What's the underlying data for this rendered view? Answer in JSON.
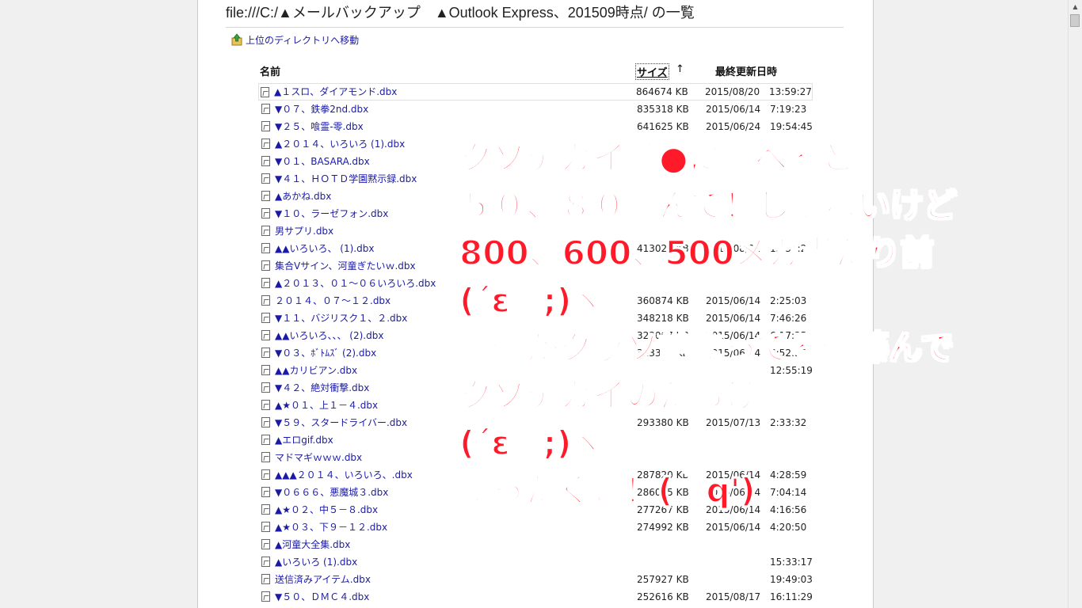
{
  "title": "file:///C:/▲メールバックアップ　▲Outlook Express、201509時点/ の一覧",
  "updir_label": "上位のディレクトリへ移動",
  "columns": {
    "name": "名前",
    "size": "サイズ",
    "sort_arrow": "↑",
    "modified": "最終更新日時"
  },
  "files": [
    {
      "name": "▲１スロ、ダイアモンド.dbx",
      "size": "864674 KB",
      "date": "2015/08/20",
      "time": "13:59:27"
    },
    {
      "name": "▼０７、鉄拳2nd.dbx",
      "size": "835318 KB",
      "date": "2015/06/14",
      "time": "7:19:23"
    },
    {
      "name": "▼２５、喰霊-零.dbx",
      "size": "641625 KB",
      "date": "2015/06/24",
      "time": "19:54:45"
    },
    {
      "name": "▲２０１４、いろいろ (1).dbx",
      "size": "",
      "date": "",
      "time": ""
    },
    {
      "name": "▼０１、BASARA.dbx",
      "size": "",
      "date": "",
      "time": ""
    },
    {
      "name": "▼４１、ＨＯＴＤ学園黙示録.dbx",
      "size": "",
      "date": "",
      "time": ""
    },
    {
      "name": "▲あかね.dbx",
      "size": "",
      "date": "",
      "time": ""
    },
    {
      "name": "▼１０、ラーゼフォン.dbx",
      "size": "",
      "date": "",
      "time": ""
    },
    {
      "name": "男サプリ.dbx",
      "size": "",
      "date": "",
      "time": ""
    },
    {
      "name": "▲▲いろいろ、 (1).dbx",
      "size": "413027 KB",
      "date": "2015/08/21",
      "time": "15:36:20"
    },
    {
      "name": "集合Vサイン、河童ぎたいｗ.dbx",
      "size": "",
      "date": "",
      "time": ""
    },
    {
      "name": "▲２０１３、０１～０６いろいろ.dbx",
      "size": "",
      "date": "",
      "time": ""
    },
    {
      "name": "２０１４、０７～１２.dbx",
      "size": "360874 KB",
      "date": "2015/06/14",
      "time": "2:25:03"
    },
    {
      "name": "▼１１、バジリスク１、２.dbx",
      "size": "348218 KB",
      "date": "2015/06/14",
      "time": "7:46:26"
    },
    {
      "name": "▲▲いろいろ、、、 (2).dbx",
      "size": "323007 KB",
      "date": "2015/06/14",
      "time": "6:17:35"
    },
    {
      "name": "▼０３、ﾎﾞﾄﾑｽﾞ (2).dbx",
      "size": "313368 KB",
      "date": "2015/06/14",
      "time": "6:52:36"
    },
    {
      "name": "▲▲カリビアン.dbx",
      "size": "",
      "date": "",
      "time": "12:55:19"
    },
    {
      "name": "▼４２、絶対衝撃.dbx",
      "size": "",
      "date": "",
      "time": ""
    },
    {
      "name": "▲★０１、上１－４.dbx",
      "size": "",
      "date": "",
      "time": ""
    },
    {
      "name": "▼５９、スタードライバー.dbx",
      "size": "293380 KB",
      "date": "2015/07/13",
      "time": "2:33:32"
    },
    {
      "name": "▲エロgif.dbx",
      "size": "",
      "date": "",
      "time": ""
    },
    {
      "name": "マドマギｗｗｗ.dbx",
      "size": "",
      "date": "",
      "time": ""
    },
    {
      "name": "▲▲▲２０１４、いろいろ、.dbx",
      "size": "287820 KB",
      "date": "2015/06/14",
      "time": "4:28:59"
    },
    {
      "name": "▼０６６６、悪魔城３.dbx",
      "size": "286095 KB",
      "date": "2015/06/14",
      "time": "7:04:14"
    },
    {
      "name": "▲★０２、中５－８.dbx",
      "size": "277267 KB",
      "date": "2015/06/14",
      "time": "4:16:56"
    },
    {
      "name": "▲★０３、下９－１２.dbx",
      "size": "274992 KB",
      "date": "2015/06/14",
      "time": "4:20:50"
    },
    {
      "name": "▲河童大全集.dbx",
      "size": "",
      "date": "",
      "time": ""
    },
    {
      "name": "▲いろいろ (1).dbx",
      "size": "",
      "date": "",
      "time": "15:33:17"
    },
    {
      "name": "送信済みアイテム.dbx",
      "size": "257927 KB",
      "date": "",
      "time": "19:49:03"
    },
    {
      "name": "▼５０、ＤＭＣ４.dbx",
      "size": "252616 KB",
      "date": "2015/08/17",
      "time": "16:11:29"
    }
  ],
  "overlay": [
    "クソデカイ順●に並べると",
    "５０、８０喜んで！じゃないけど",
    "800、600、500メガ当たり前",
    "(´ε｀;)ヾ",
    "画像がクッソ詰まってる伊藤んで",
    "クソデカイのだらけ",
    "(´ε｀;)ヾ",
    "まったくさ！(｀q')"
  ]
}
